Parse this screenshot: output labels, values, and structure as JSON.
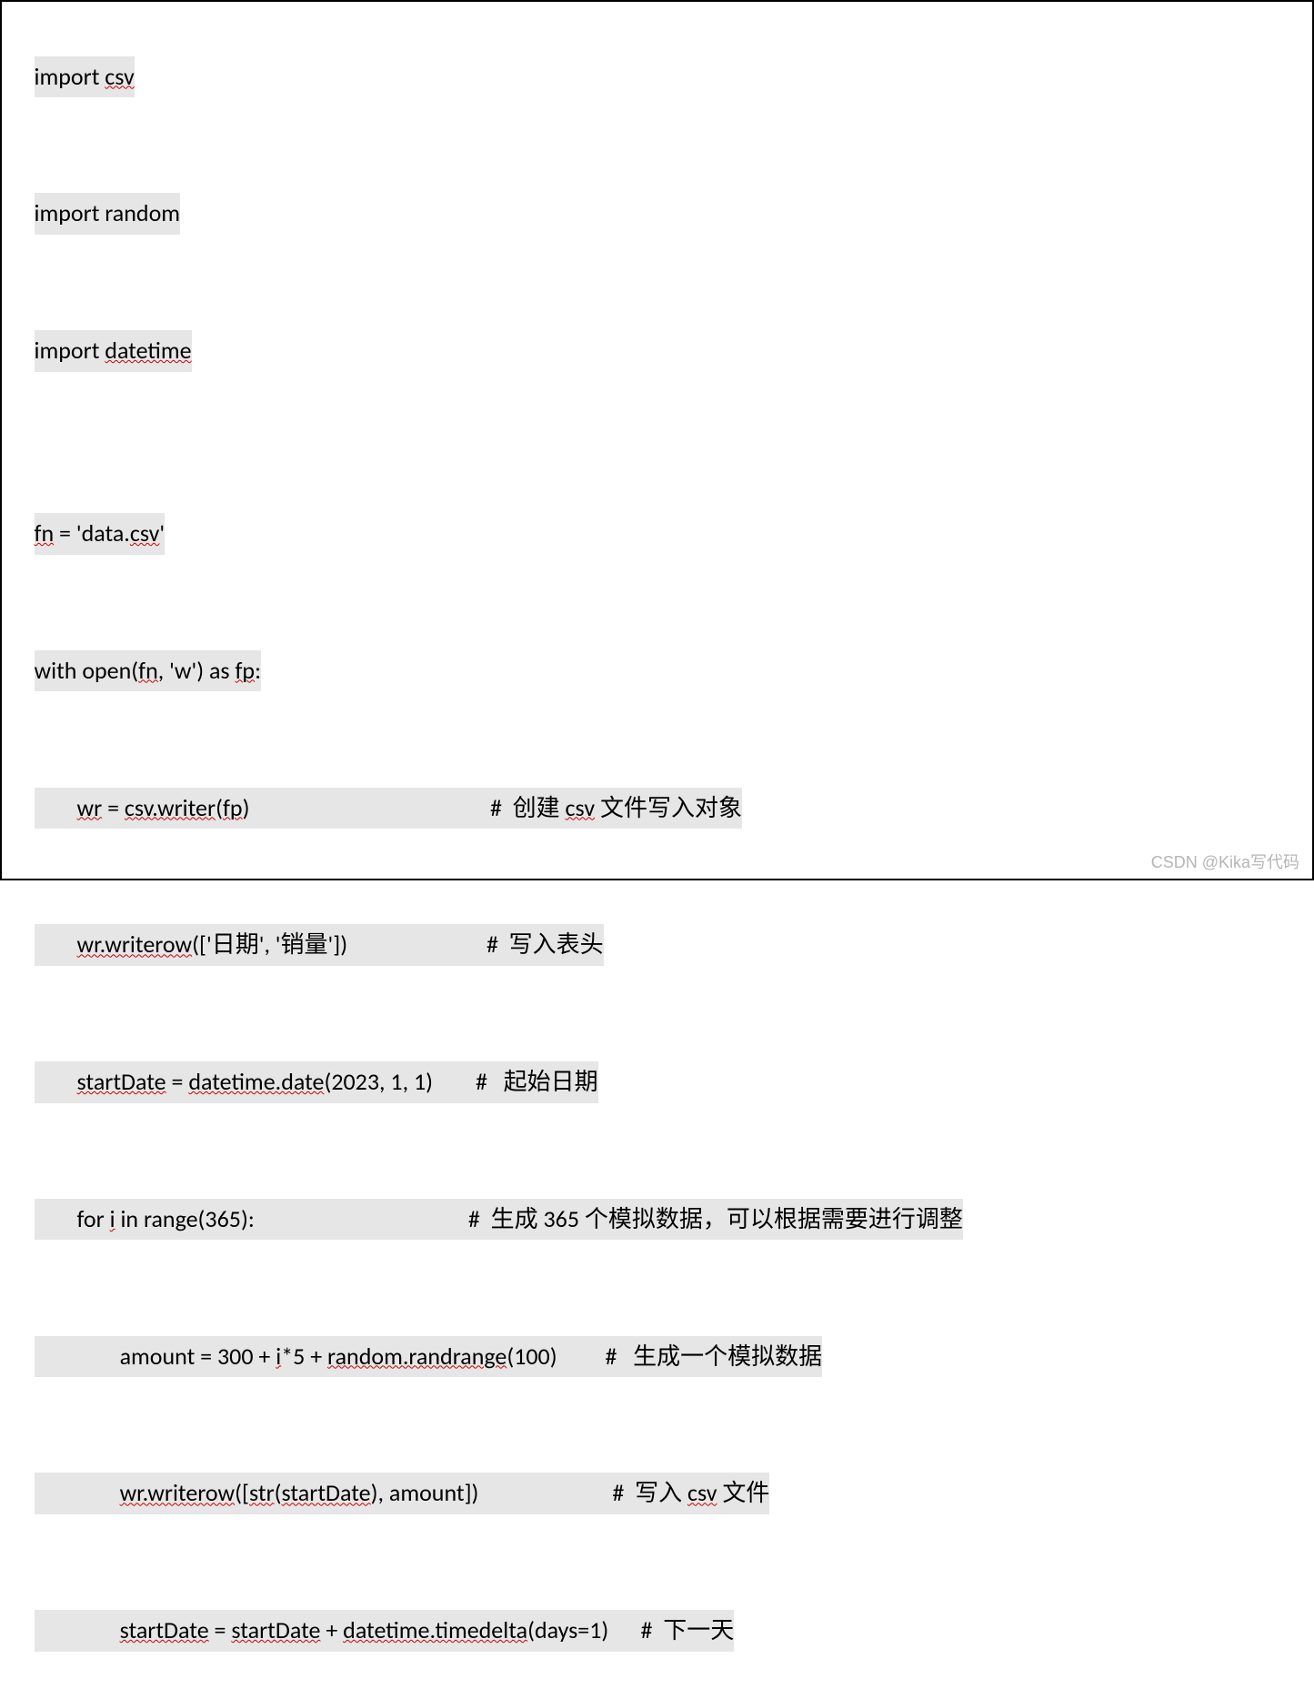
{
  "lines": {
    "l1": {
      "t1": "import ",
      "u1": "csv"
    },
    "l2": {
      "t1": "import random"
    },
    "l3": {
      "t1": "import ",
      "u1": "datetime"
    },
    "l4": {
      "t1": "fn",
      "t2": " = 'data.",
      "u1": "csv",
      "t3": "'"
    },
    "l5": {
      "t1": "with open(",
      "u1": "fn",
      "t2": ", 'w') as ",
      "u2": "fp",
      "t3": ":"
    },
    "l6": {
      "t1": "        ",
      "u1": "wr",
      "t2": " = ",
      "u2": "csv.writer",
      "t3": "(",
      "u3": "fp",
      "t4": ")                                             #  创建 ",
      "u4": "csv",
      "t5": " 文件写入对象"
    },
    "l7": {
      "t1": "        ",
      "u1": "wr.writerow",
      "t2": "(['日期', '销量'])                          #  写入表头"
    },
    "l8": {
      "t1": "        ",
      "u1": "startDate",
      "t2": " = ",
      "u2": "datetime.date",
      "t3": "(2023, 1, 1)        #   起始日期"
    },
    "l9": {
      "t1": "        for ",
      "u1": "i",
      "t2": " in range(365):                                        #  生成 365 个模拟数据，可以根据需要进行调整"
    },
    "l10": {
      "t1": "                amount = 300 + ",
      "u1": "i",
      "t2": "*5 + ",
      "u2": "random.randrange",
      "t3": "(100)         #   生成一个模拟数据"
    },
    "l11": {
      "t1": "                ",
      "u1": "wr.writerow",
      "t2": "([",
      "u2": "str",
      "t3": "(",
      "u3": "startDate",
      "t4": "), amount])                         #  写入 ",
      "u4": "csv",
      "t5": " 文件"
    },
    "l12": {
      "t1": "                ",
      "u1": "startDate",
      "t2": " = ",
      "u2": "startDate",
      "t3": " + ",
      "u3": "datetime.timedelta",
      "t4": "(days=1)      #  下一天"
    }
  },
  "watermark": "CSDN @Kika写代码"
}
